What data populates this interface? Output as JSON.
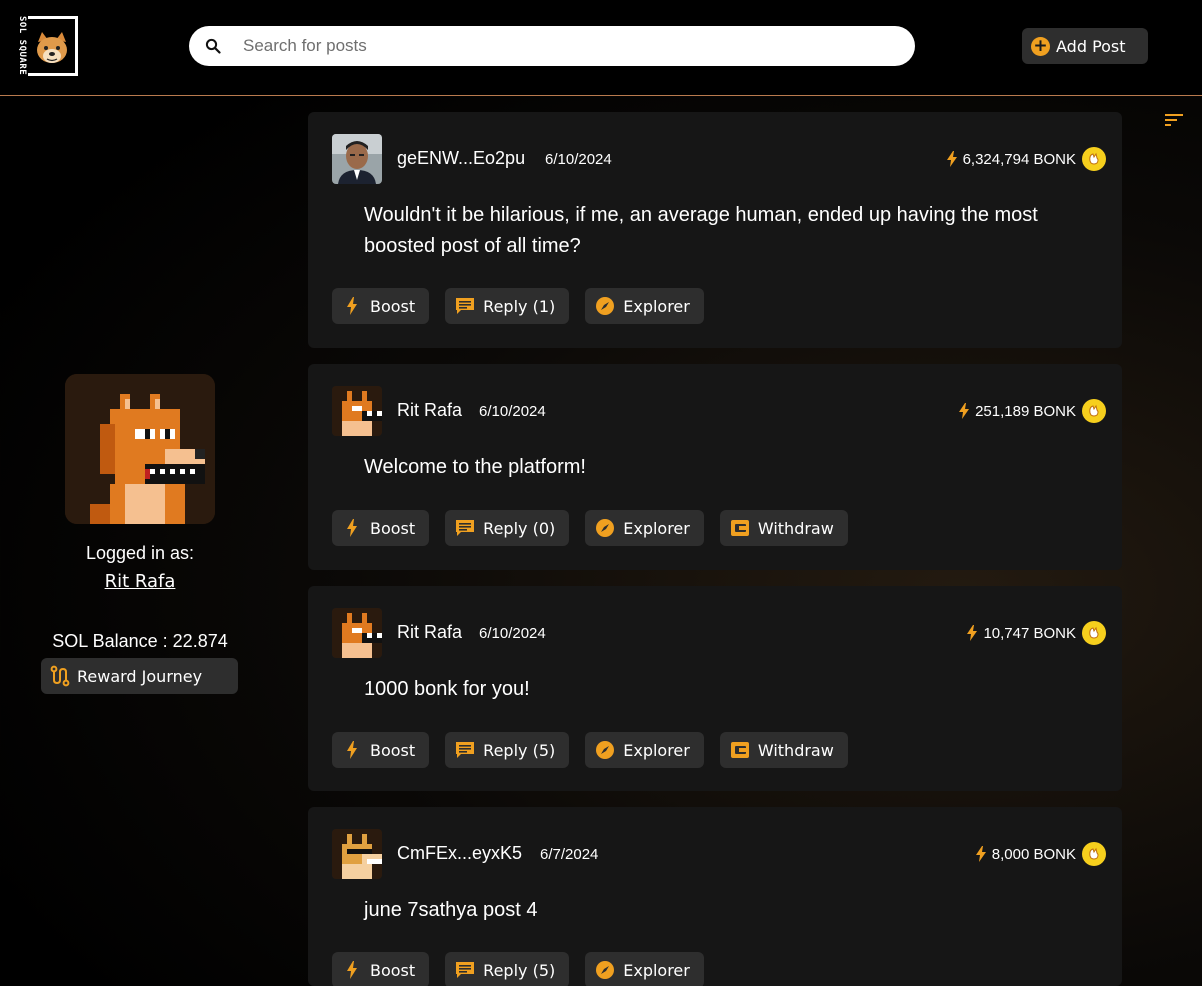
{
  "header": {
    "logo_text": "SOL SQUARE",
    "search_placeholder": "Search for posts",
    "add_post_label": "Add Post"
  },
  "sidebar": {
    "logged_in_label": "Logged in as:",
    "username": "Rit Rafa",
    "sol_balance": "SOL Balance : 22.874",
    "reward_label": "Reward Journey"
  },
  "posts": [
    {
      "author": "geENW...Eo2pu",
      "date": "6/10/2024",
      "bonk": "6,324,794 BONK",
      "text": "Wouldn't it be hilarious, if me, an average human, ended up having the most boosted post of all time?",
      "boost": "Boost",
      "reply": "Reply (1)",
      "explorer": "Explorer"
    },
    {
      "author": "Rit Rafa",
      "date": "6/10/2024",
      "bonk": "251,189 BONK",
      "text": "Welcome to the platform!",
      "boost": "Boost",
      "reply": "Reply (0)",
      "explorer": "Explorer",
      "withdraw": "Withdraw"
    },
    {
      "author": "Rit Rafa",
      "date": "6/10/2024",
      "bonk": "10,747 BONK",
      "text": "1000 bonk for you!",
      "boost": "Boost",
      "reply": "Reply (5)",
      "explorer": "Explorer",
      "withdraw": "Withdraw"
    },
    {
      "author": "CmFEx...eyxK5",
      "date": "6/7/2024",
      "bonk": "8,000 BONK",
      "text": "june 7sathya post 4",
      "boost": "Boost",
      "reply": "Reply (5)",
      "explorer": "Explorer"
    }
  ],
  "colors": {
    "accent": "#f0a020",
    "bonk_coin": "#f6cf1d",
    "card": "#161616",
    "button": "#2e2e2e"
  },
  "icons": {
    "search": "search-icon",
    "add": "plus-circle-icon",
    "sort": "sort-icon",
    "boost": "lightning-icon",
    "reply": "comment-icon",
    "explorer": "compass-icon",
    "withdraw": "wallet-icon",
    "reward": "route-icon"
  }
}
